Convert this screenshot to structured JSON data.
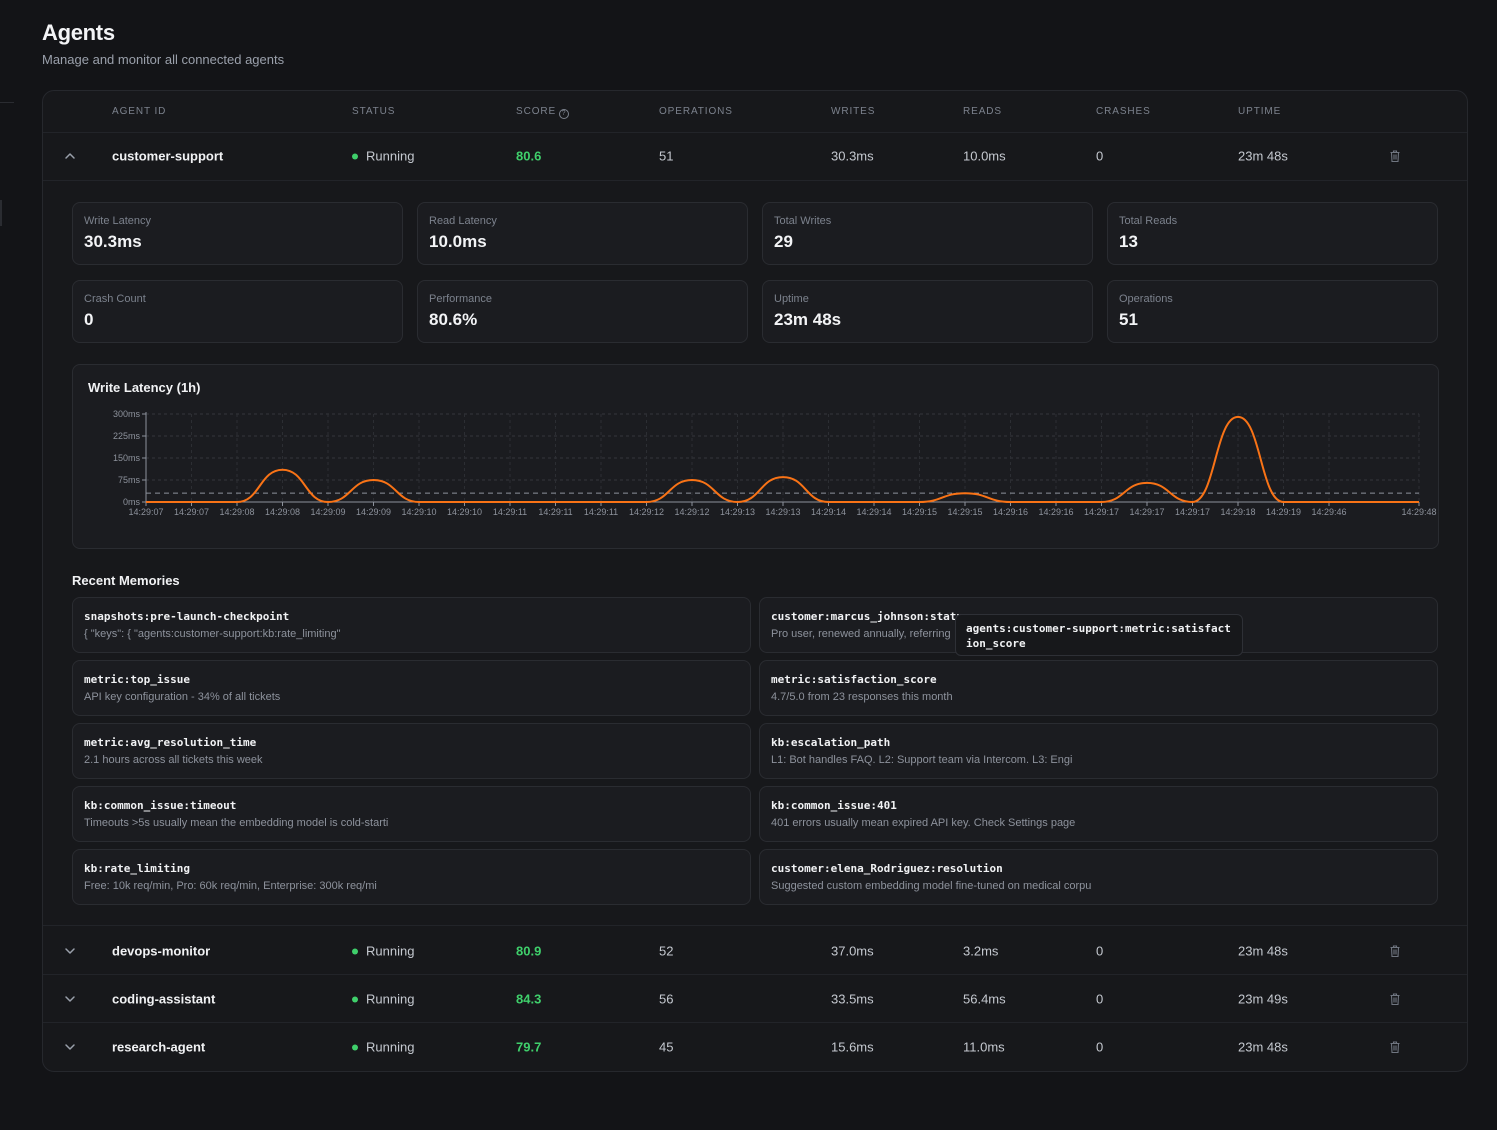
{
  "page": {
    "title": "Agents",
    "subtitle": "Manage and monitor all connected agents"
  },
  "table": {
    "columns": [
      "AGENT ID",
      "STATUS",
      "SCORE",
      "OPERATIONS",
      "WRITES",
      "READS",
      "CRASHES",
      "UPTIME"
    ],
    "score_help_icon": "question-circle-icon",
    "rows": [
      {
        "id": "customer-support",
        "status": "Running",
        "score": "80.6",
        "operations": "51",
        "writes": "30.3ms",
        "reads": "10.0ms",
        "crashes": "0",
        "uptime": "23m 48s",
        "expanded": true
      },
      {
        "id": "devops-monitor",
        "status": "Running",
        "score": "80.9",
        "operations": "52",
        "writes": "37.0ms",
        "reads": "3.2ms",
        "crashes": "0",
        "uptime": "23m 48s",
        "expanded": false
      },
      {
        "id": "coding-assistant",
        "status": "Running",
        "score": "84.3",
        "operations": "56",
        "writes": "33.5ms",
        "reads": "56.4ms",
        "crashes": "0",
        "uptime": "23m 49s",
        "expanded": false
      },
      {
        "id": "research-agent",
        "status": "Running",
        "score": "79.7",
        "operations": "45",
        "writes": "15.6ms",
        "reads": "11.0ms",
        "crashes": "0",
        "uptime": "23m 48s",
        "expanded": false
      }
    ]
  },
  "details": {
    "stats": [
      {
        "label": "Write Latency",
        "value": "30.3ms"
      },
      {
        "label": "Read Latency",
        "value": "10.0ms"
      },
      {
        "label": "Total Writes",
        "value": "29"
      },
      {
        "label": "Total Reads",
        "value": "13"
      },
      {
        "label": "Crash Count",
        "value": "0"
      },
      {
        "label": "Performance",
        "value": "80.6%"
      },
      {
        "label": "Uptime",
        "value": "23m 48s"
      },
      {
        "label": "Operations",
        "value": "51"
      }
    ],
    "chart_title": "Write Latency (1h)",
    "memories_title": "Recent Memories",
    "memories": [
      {
        "key": "snapshots:pre-launch-checkpoint",
        "value": "{ \"keys\": { \"agents:customer-support:kb:rate_limiting\""
      },
      {
        "key": "customer:marcus_johnson:status",
        "value": "Pro user, renewed annually, referring"
      },
      {
        "key": "metric:top_issue",
        "value": "API key configuration - 34% of all tickets"
      },
      {
        "key": "metric:satisfaction_score",
        "value": "4.7/5.0 from 23 responses this month"
      },
      {
        "key": "metric:avg_resolution_time",
        "value": "2.1 hours across all tickets this week"
      },
      {
        "key": "kb:escalation_path",
        "value": "L1: Bot handles FAQ. L2: Support team via Intercom. L3: Engi"
      },
      {
        "key": "kb:common_issue:timeout",
        "value": "Timeouts >5s usually mean the embedding model is cold-starti"
      },
      {
        "key": "kb:common_issue:401",
        "value": "401 errors usually mean expired API key. Check Settings page"
      },
      {
        "key": "kb:rate_limiting",
        "value": "Free: 10k req/min, Pro: 60k req/min, Enterprise: 300k req/mi"
      },
      {
        "key": "customer:elena_Rodriguez:resolution",
        "value": "Suggested custom embedding model fine-tuned on medical corpu"
      }
    ],
    "tooltip": "agents:customer-support:metric:satisfaction_score"
  },
  "chart_data": {
    "type": "line",
    "title": "Write Latency (1h)",
    "y_unit": "ms",
    "ylim": [
      0,
      300
    ],
    "y_ticks": [
      "0ms",
      "75ms",
      "150ms",
      "225ms",
      "300ms"
    ],
    "y_tick_values": [
      0,
      75,
      150,
      225,
      300
    ],
    "grid": true,
    "x": [
      "14:29:07",
      "14:29:07",
      "14:29:08",
      "14:29:08",
      "14:29:09",
      "14:29:09",
      "14:29:10",
      "14:29:10",
      "14:29:11",
      "14:29:11",
      "14:29:11",
      "14:29:12",
      "14:29:12",
      "14:29:13",
      "14:29:13",
      "14:29:14",
      "14:29:14",
      "14:29:15",
      "14:29:15",
      "14:29:16",
      "14:29:16",
      "14:29:17",
      "14:29:17",
      "14:29:17",
      "14:29:18",
      "14:29:19",
      "14:29:46",
      "14:29:48"
    ],
    "values": [
      0,
      0,
      0,
      110,
      0,
      75,
      0,
      0,
      0,
      0,
      0,
      0,
      75,
      0,
      85,
      0,
      0,
      0,
      30,
      0,
      0,
      0,
      65,
      0,
      290,
      0,
      0,
      0
    ],
    "reference_line": 30.3,
    "color": "#f97316"
  },
  "colors": {
    "accent_green": "#3fcf6b",
    "line_orange": "#f97316",
    "background": "#131417"
  }
}
